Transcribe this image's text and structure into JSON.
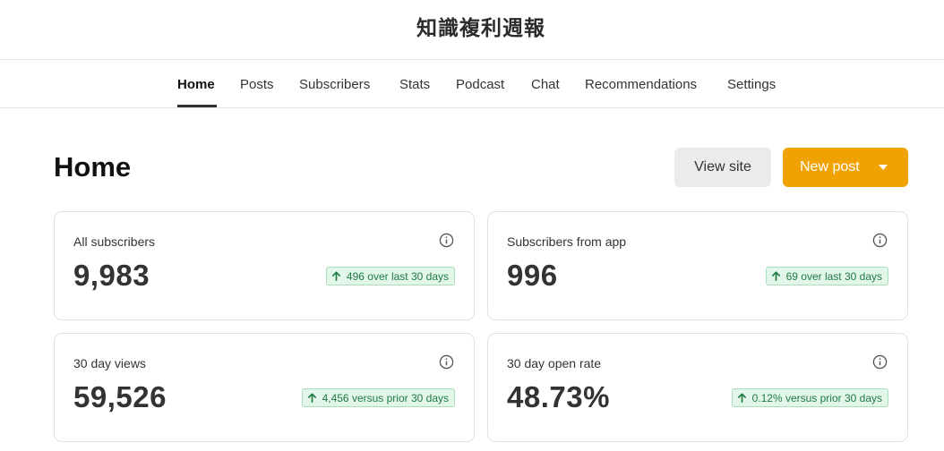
{
  "publication": {
    "title": "知識複利週報"
  },
  "nav": {
    "items": [
      {
        "label": "Home",
        "active": true
      },
      {
        "label": "Posts"
      },
      {
        "label": "Subscribers"
      },
      {
        "label": "Stats"
      },
      {
        "label": "Podcast"
      },
      {
        "label": "Chat"
      },
      {
        "label": "Recommendations"
      },
      {
        "label": "Settings"
      }
    ]
  },
  "page": {
    "title": "Home"
  },
  "actions": {
    "view_site": "View site",
    "new_post": "New post"
  },
  "cards": [
    {
      "label": "All subscribers",
      "value": "9,983",
      "delta": "496 over last 30 days",
      "trend": "up"
    },
    {
      "label": "Subscribers from app",
      "value": "996",
      "delta": "69 over last 30 days",
      "trend": "up"
    },
    {
      "label": "30 day views",
      "value": "59,526",
      "delta": "4,456 versus prior 30 days",
      "trend": "up"
    },
    {
      "label": "30 day open rate",
      "value": "48.73%",
      "delta": "0.12% versus prior 30 days",
      "trend": "up"
    }
  ],
  "colors": {
    "accent": "#f0a202",
    "positive_bg": "#e3f6ea",
    "positive_text": "#1f7a44"
  }
}
